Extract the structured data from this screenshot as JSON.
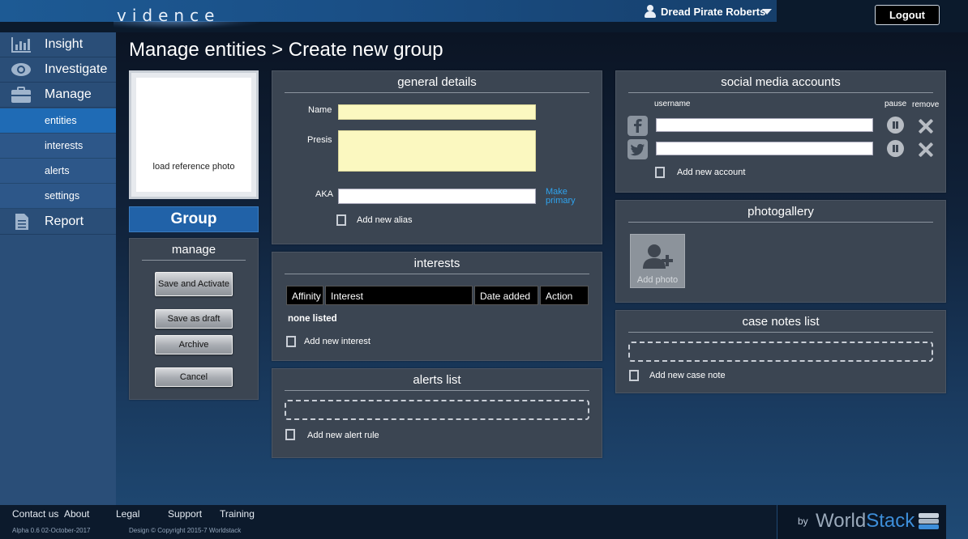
{
  "header": {
    "logo": "vidence",
    "user_name": "Dread Pirate Roberts",
    "logout_label": "Logout"
  },
  "sidebar": {
    "items": [
      {
        "label": "Insight",
        "icon": "bar-chart-icon"
      },
      {
        "label": "Investigate",
        "icon": "eye-icon"
      },
      {
        "label": "Manage",
        "icon": "briefcase-icon"
      }
    ],
    "sub_items": [
      {
        "label": "entities",
        "active": true
      },
      {
        "label": "interests",
        "active": false
      },
      {
        "label": "alerts",
        "active": false
      },
      {
        "label": "settings",
        "active": false
      }
    ],
    "report": {
      "label": "Report",
      "icon": "document-icon"
    }
  },
  "page": {
    "title": "Manage entities > Create new group"
  },
  "photo": {
    "label": "load reference photo"
  },
  "entity_type_button": "Group",
  "manage_panel": {
    "title": "manage",
    "buttons": {
      "save_activate": "Save and Activate",
      "save_draft": "Save as draft",
      "archive": "Archive",
      "cancel": "Cancel"
    }
  },
  "general_details": {
    "title": "general details",
    "name_label": "Name",
    "name_value": "",
    "presis_label": "Presis",
    "presis_value": "",
    "aka_label": "AKA",
    "aka_value": "",
    "make_primary_line1": "Make",
    "make_primary_line2": "primary",
    "add_alias_label": "Add new alias"
  },
  "interests": {
    "title": "interests",
    "columns": [
      "Affinity",
      "Interest",
      "Date added",
      "Action"
    ],
    "empty_text": "none listed",
    "add_label": "Add new interest"
  },
  "alerts_list": {
    "title": "alerts list",
    "add_label": "Add new alert rule"
  },
  "social_media": {
    "title": "social media accounts",
    "username_header": "username",
    "pause_header": "pause",
    "remove_header": "remove",
    "accounts": [
      {
        "network": "facebook",
        "username": ""
      },
      {
        "network": "twitter",
        "username": ""
      }
    ],
    "add_label": "Add new account"
  },
  "photogallery": {
    "title": "photogallery",
    "add_photo_label": "Add photo"
  },
  "case_notes": {
    "title": "case notes list",
    "add_label": "Add new case note"
  },
  "footer": {
    "links": [
      "Contact us",
      "About",
      "Legal",
      "Support",
      "Training"
    ],
    "version": "Alpha 0.6 02-October-2017",
    "copyright": "Design © Copyright 2015-7 Worldstack",
    "brand_by": "by",
    "brand_name_part1": "World",
    "brand_name_part2": "Stack"
  },
  "colors": {
    "accent": "#1f6bb5",
    "panel": "#3b4552",
    "input_yellow": "#fbf8c0",
    "link": "#2fa3ee"
  }
}
